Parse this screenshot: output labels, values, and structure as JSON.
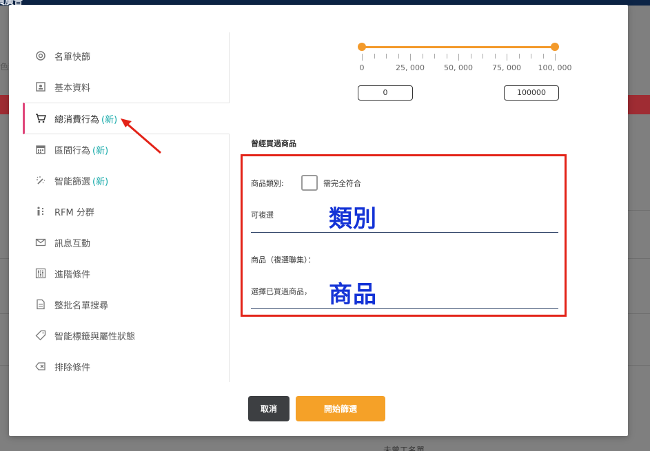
{
  "background": {
    "title": "員廣告",
    "side_text": "色新",
    "bottom_text": "未曾工名單"
  },
  "sidebar": {
    "items": [
      {
        "label": "名單快篩",
        "icon": "at-icon",
        "new": ""
      },
      {
        "label": "基本資料",
        "icon": "id-card-icon",
        "new": ""
      },
      {
        "label": "總消費行為",
        "icon": "cart-icon",
        "new": "(新)"
      },
      {
        "label": "區間行為",
        "icon": "calendar-icon",
        "new": "(新)"
      },
      {
        "label": "智能篩選",
        "icon": "magic-wand-icon",
        "new": "(新)"
      },
      {
        "label": "RFM 分群",
        "icon": "person-chart-icon",
        "new": ""
      },
      {
        "label": "訊息互動",
        "icon": "envelope-icon",
        "new": ""
      },
      {
        "label": "進階條件",
        "icon": "sliders-icon",
        "new": ""
      },
      {
        "label": "整批名單搜尋",
        "icon": "document-icon",
        "new": ""
      },
      {
        "label": "智能標籤與屬性狀態",
        "icon": "tag-icon",
        "new": ""
      },
      {
        "label": "排除條件",
        "icon": "backspace-icon",
        "new": ""
      }
    ],
    "active_index": 2
  },
  "slider": {
    "min_value": "0",
    "max_value": "100000",
    "tick_labels": [
      "0",
      "25, 000",
      "50, 000",
      "75, 000",
      "100, 000"
    ],
    "accent": "#f39a2b"
  },
  "section": {
    "title": "曾經買過商品",
    "category_label": "商品類別:",
    "exact_match_label": "需完全符合",
    "category_placeholder": "可複選",
    "category_overlay": "類別",
    "product_label": "商品（複選聯集）：",
    "product_placeholder": "選擇已買過商品，",
    "product_overlay": "商品"
  },
  "footer": {
    "cancel_label": "取消",
    "start_label": "開始篩選"
  }
}
